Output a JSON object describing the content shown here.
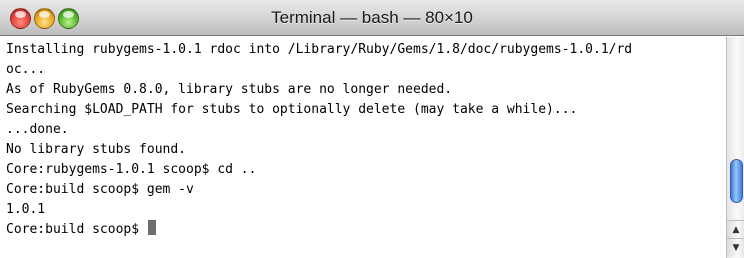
{
  "window": {
    "title": "Terminal — bash — 80×10"
  },
  "terminal": {
    "lines": [
      "Installing rubygems-1.0.1 rdoc into /Library/Ruby/Gems/1.8/doc/rubygems-1.0.1/rd",
      "oc...",
      "As of RubyGems 0.8.0, library stubs are no longer needed.",
      "Searching $LOAD_PATH for stubs to optionally delete (may take a while)...",
      "...done.",
      "No library stubs found.",
      "Core:rubygems-1.0.1 scoop$ cd ..",
      "Core:build scoop$ gem -v",
      "1.0.1",
      "Core:build scoop$ "
    ]
  },
  "icons": {
    "close": "close-icon",
    "minimize": "minimize-icon",
    "zoom": "zoom-icon",
    "scroll_up": "arrow-up-icon",
    "scroll_down": "arrow-down-icon"
  },
  "colors": {
    "close": "#e0443a",
    "minimize": "#e9a51e",
    "zoom": "#59b62d",
    "scroll_thumb": "#3a78d8"
  }
}
